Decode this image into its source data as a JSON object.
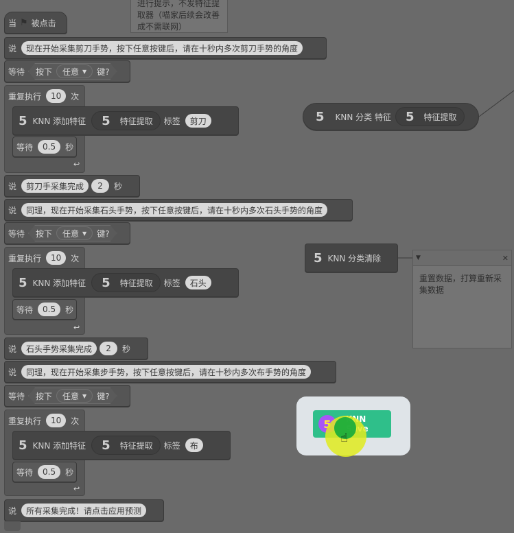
{
  "top_note": {
    "lines": [
      "进行提示，不发特征提",
      "取器（喵家后续会改善",
      "成不需联网）"
    ]
  },
  "hat": {
    "prefix": "当",
    "flag_icon": "green-flag-icon",
    "suffix": "被点击"
  },
  "say1": {
    "label": "说",
    "text": "现在开始采集剪刀手势，按下任意按键后，请在十秒内多次剪刀手势的角度"
  },
  "wait_key1": {
    "label": "等待",
    "pressed": "按下",
    "key": "任意",
    "suffix": "键?"
  },
  "repeat1": {
    "label": "重复执行",
    "count": "10",
    "suffix": "次"
  },
  "knn_add1": {
    "five": "5",
    "label": "KNN 添加特征",
    "inner_five": "5",
    "extract": "特征提取",
    "tag_label": "标签",
    "tag": "剪刀"
  },
  "wait1": {
    "label": "等待",
    "value": "0.5",
    "unit": "秒"
  },
  "say2": {
    "label": "说",
    "text": "剪刀手采集完成",
    "secs": "2",
    "unit": "秒"
  },
  "say3": {
    "label": "说",
    "text": "同理，现在开始采集石头手势，按下任意按键后，请在十秒内多次石头手势的角度"
  },
  "wait_key2": {
    "label": "等待",
    "pressed": "按下",
    "key": "任意",
    "suffix": "键?"
  },
  "repeat2": {
    "label": "重复执行",
    "count": "10",
    "suffix": "次"
  },
  "knn_add2": {
    "five": "5",
    "label": "KNN 添加特征",
    "inner_five": "5",
    "extract": "特征提取",
    "tag_label": "标签",
    "tag": "石头"
  },
  "wait2": {
    "label": "等待",
    "value": "0.5",
    "unit": "秒"
  },
  "say4": {
    "label": "说",
    "text": "石头手势采集完成",
    "secs": "2",
    "unit": "秒"
  },
  "say5": {
    "label": "说",
    "text": "同理，现在开始采集步手势，按下任意按键后，请在十秒内多次布手势的角度"
  },
  "wait_key3": {
    "label": "等待",
    "pressed": "按下",
    "key": "任意",
    "suffix": "键?"
  },
  "repeat3": {
    "label": "重复执行",
    "count": "10",
    "suffix": "次"
  },
  "knn_add3": {
    "five": "5",
    "label": "KNN 添加特征",
    "inner_five": "5",
    "extract": "特征提取",
    "tag_label": "标签",
    "tag": "布"
  },
  "wait3": {
    "label": "等待",
    "value": "0.5",
    "unit": "秒"
  },
  "say6": {
    "label": "说",
    "text": "所有采集完成！请点击应用预测"
  },
  "knn_classify": {
    "five": "5",
    "label": "KNN 分类 特征",
    "inner_five": "5",
    "extract": "特征提取"
  },
  "knn_clear": {
    "five": "5",
    "label": "KNN 分类清除"
  },
  "clear_note": {
    "text": "重置数据，打算重新采集数据",
    "collapse_icon": "triangle-down-icon",
    "close_icon": "close-icon",
    "close_glyph": "✕"
  },
  "knn_save": {
    "five": "5",
    "label": "KNN Save",
    "accent": "#2fbf8a",
    "badge_color": "#a855f7"
  }
}
